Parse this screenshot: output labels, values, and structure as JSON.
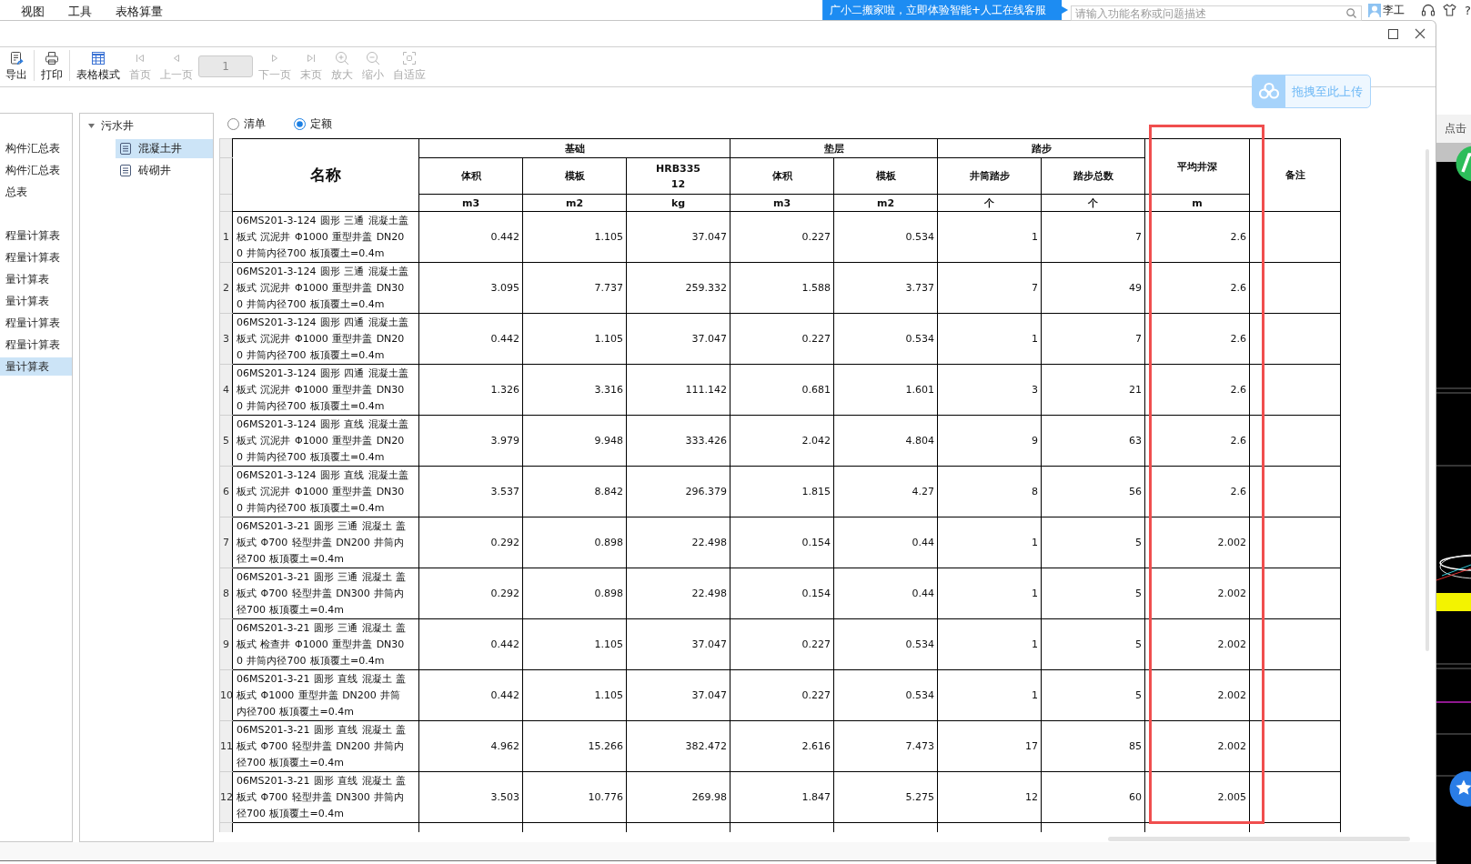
{
  "menu_bar": {
    "items": [
      "视图",
      "工具",
      "表格算量"
    ]
  },
  "top_right": {
    "banner": "广小二搬家啦，立即体验智能+人工在线客服",
    "search": {
      "placeholder": "请输入功能名称或问题描述"
    },
    "user_name": "李工",
    "help": "?"
  },
  "dialog": {
    "toolbar": {
      "groups": [
        [
          {
            "kind": "button",
            "label": "导出",
            "disabled": false
          }
        ],
        [
          {
            "kind": "button",
            "label": "打印",
            "disabled": false
          }
        ],
        [
          {
            "kind": "button",
            "label": "表格模式",
            "disabled": false
          },
          {
            "kind": "button",
            "label": "首页",
            "disabled": true
          },
          {
            "kind": "button",
            "label": "上一页",
            "disabled": true
          },
          {
            "kind": "page-field",
            "value": "1",
            "disabled": true
          },
          {
            "kind": "button",
            "label": "下一页",
            "disabled": true
          },
          {
            "kind": "button",
            "label": "末页",
            "disabled": true
          },
          {
            "kind": "button",
            "label": "放大",
            "disabled": true
          },
          {
            "kind": "button",
            "label": "缩小",
            "disabled": true
          },
          {
            "kind": "button",
            "label": "自适应",
            "disabled": true
          }
        ]
      ]
    },
    "upload_badge": {
      "label": "拖拽至此上传"
    },
    "report_list": {
      "groups": [
        [
          {
            "label": "构件汇总表",
            "selected": false
          },
          {
            "label": "构件汇总表",
            "selected": false
          },
          {
            "label": "总表",
            "selected": false
          }
        ],
        [
          {
            "label": "程量计算表",
            "selected": false
          },
          {
            "label": "程量计算表",
            "selected": false
          },
          {
            "label": "量计算表",
            "selected": false
          },
          {
            "label": "量计算表",
            "selected": false
          },
          {
            "label": "程量计算表",
            "selected": false
          },
          {
            "label": "程量计算表",
            "selected": false
          },
          {
            "label": "量计算表",
            "selected": true
          }
        ]
      ]
    },
    "tree": {
      "items": [
        {
          "label": "污水井",
          "expanded": true,
          "selected": false,
          "children": [
            {
              "label": "混凝土井",
              "selected": true
            },
            {
              "label": "砖砌井",
              "selected": false
            }
          ]
        }
      ]
    },
    "mode_options": [
      {
        "label": "清单",
        "selected": false
      },
      {
        "label": "定额",
        "selected": true
      }
    ],
    "table": {
      "name_header": "名称",
      "column_groups": [
        {
          "label": "基础",
          "columns": [
            {
              "label": "体积",
              "unit": "m3"
            },
            {
              "label": "模板",
              "unit": "m2"
            },
            {
              "label": "HRB335\n12",
              "unit": "kg"
            }
          ]
        },
        {
          "label": "垫层",
          "columns": [
            {
              "label": "体积",
              "unit": "m3"
            },
            {
              "label": "模板",
              "unit": "m2"
            }
          ]
        },
        {
          "label": "踏步",
          "columns": [
            {
              "label": "井筒踏步",
              "unit": "个"
            },
            {
              "label": "踏步总数",
              "unit": "个"
            }
          ]
        }
      ],
      "extra_columns": [
        {
          "label": "平均井深",
          "unit": "m",
          "highlighted": true
        },
        {
          "label": "备注"
        }
      ],
      "rows": [
        {
          "number": "1",
          "name": "06MS201-3-124 圆形 三通 混凝土盖板式 沉泥井 Φ1000 重型井盖 DN200 井筒内径700 板顶覆土=0.4m",
          "values": [
            "0.442",
            "1.105",
            "37.047",
            "0.227",
            "0.534",
            "1",
            "7",
            "2.6"
          ]
        },
        {
          "number": "2",
          "name": "06MS201-3-124 圆形 三通 混凝土盖板式 沉泥井 Φ1000 重型井盖 DN300 井筒内径700 板顶覆土=0.4m",
          "values": [
            "3.095",
            "7.737",
            "259.332",
            "1.588",
            "3.737",
            "7",
            "49",
            "2.6"
          ]
        },
        {
          "number": "3",
          "name": "06MS201-3-124 圆形 四通 混凝土盖板式 沉泥井 Φ1000 重型井盖 DN200 井筒内径700 板顶覆土=0.4m",
          "values": [
            "0.442",
            "1.105",
            "37.047",
            "0.227",
            "0.534",
            "1",
            "7",
            "2.6"
          ]
        },
        {
          "number": "4",
          "name": "06MS201-3-124 圆形 四通 混凝土盖板式 沉泥井 Φ1000 重型井盖 DN300 井筒内径700 板顶覆土=0.4m",
          "values": [
            "1.326",
            "3.316",
            "111.142",
            "0.681",
            "1.601",
            "3",
            "21",
            "2.6"
          ]
        },
        {
          "number": "5",
          "name": "06MS201-3-124 圆形 直线 混凝土盖板式 沉泥井 Φ1000 重型井盖 DN200 井筒内径700 板顶覆土=0.4m",
          "values": [
            "3.979",
            "9.948",
            "333.426",
            "2.042",
            "4.804",
            "9",
            "63",
            "2.6"
          ]
        },
        {
          "number": "6",
          "name": "06MS201-3-124 圆形 直线 混凝土盖板式 沉泥井 Φ1000 重型井盖 DN300 井筒内径700 板顶覆土=0.4m",
          "values": [
            "3.537",
            "8.842",
            "296.379",
            "1.815",
            "4.27",
            "8",
            "56",
            "2.6"
          ]
        },
        {
          "number": "7",
          "name": "06MS201-3-21 圆形 三通 混凝土 盖板式 Φ700 轻型井盖 DN200 井筒内径700 板顶覆土=0.4m",
          "values": [
            "0.292",
            "0.898",
            "22.498",
            "0.154",
            "0.44",
            "1",
            "5",
            "2.002"
          ]
        },
        {
          "number": "8",
          "name": "06MS201-3-21 圆形 三通 混凝土 盖板式 Φ700 轻型井盖 DN300 井筒内径700 板顶覆土=0.4m",
          "values": [
            "0.292",
            "0.898",
            "22.498",
            "0.154",
            "0.44",
            "1",
            "5",
            "2.002"
          ]
        },
        {
          "number": "9",
          "name": "06MS201-3-21 圆形 三通 混凝土 盖板式 检查井 Φ1000 重型井盖 DN300 井筒内径700 板顶覆土=0.4m",
          "values": [
            "0.442",
            "1.105",
            "37.047",
            "0.227",
            "0.534",
            "1",
            "5",
            "2.002"
          ]
        },
        {
          "number": "10",
          "name": "06MS201-3-21 圆形 直线 混凝土 盖板式 Φ1000 重型井盖 DN200 井筒内径700 板顶覆土=0.4m",
          "values": [
            "0.442",
            "1.105",
            "37.047",
            "0.227",
            "0.534",
            "1",
            "5",
            "2.002"
          ]
        },
        {
          "number": "11",
          "name": "06MS201-3-21 圆形 直线 混凝土 盖板式 Φ700 轻型井盖 DN200 井筒内径700 板顶覆土=0.4m",
          "values": [
            "4.962",
            "15.266",
            "382.472",
            "2.616",
            "7.473",
            "17",
            "85",
            "2.002"
          ]
        },
        {
          "number": "12",
          "name": "06MS201-3-21 圆形 直线 混凝土 盖板式 Φ700 轻型井盖 DN300 井筒内径700 板顶覆土=0.4m",
          "values": [
            "3.503",
            "10.776",
            "269.98",
            "1.847",
            "5.275",
            "12",
            "60",
            "2.005"
          ]
        }
      ]
    }
  },
  "background_app": {
    "side_label": "点击"
  }
}
